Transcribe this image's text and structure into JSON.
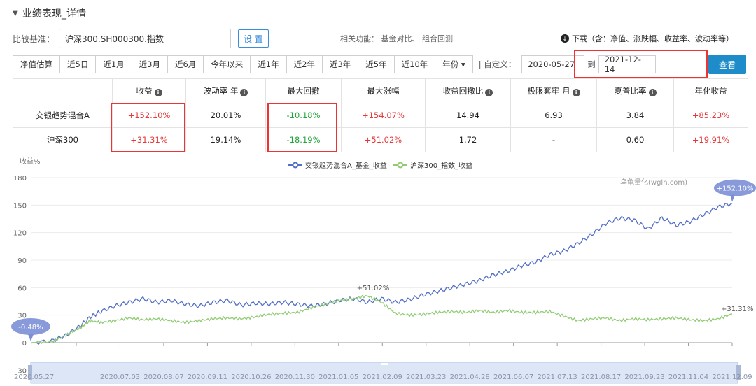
{
  "section": {
    "title": "业绩表现_详情"
  },
  "benchmark": {
    "label": "比较基准：",
    "value": "沪深300.SH000300.指数",
    "set_label": "设 置",
    "related": "相关功能： 基金对比、 组合回测",
    "download": "下载（含：净值、涨跌幅、收益率、波动率等）"
  },
  "periods": [
    "净值估算",
    "近5日",
    "近1月",
    "近3月",
    "近6月",
    "今年以来",
    "近1年",
    "近2年",
    "近3年",
    "近5年",
    "近10年",
    "年份 ▾"
  ],
  "custom": {
    "label": "| 自定义：",
    "start": "2020-05-27",
    "to": "到",
    "end": "2021-12-14",
    "query_label": "查看"
  },
  "table": {
    "headers": [
      "",
      "收益",
      "波动率 年",
      "最大回撤",
      "最大涨幅",
      "收益回撤比",
      "极限套牢 月",
      "夏普比率",
      "年化收益"
    ],
    "rows": [
      [
        "交银趋势混合A",
        "+152.10%",
        "20.01%",
        "-10.18%",
        "+154.07%",
        "14.94",
        "6.93",
        "3.84",
        "+85.23%"
      ],
      [
        "沪深300",
        "+31.31%",
        "19.14%",
        "-18.19%",
        "+51.02%",
        "1.72",
        "-",
        "0.60",
        "+19.91%"
      ]
    ]
  },
  "chart_data": {
    "type": "line",
    "ylabel": "收益%",
    "yticks": [
      -30,
      0,
      30,
      60,
      90,
      120,
      150,
      180
    ],
    "ylim": [
      -30,
      180
    ],
    "xticks": [
      "2020.05.27",
      "2020.07.03",
      "2020.08.07",
      "2020.09.11",
      "2020.10.26",
      "2020.11.30",
      "2021.01.05",
      "2021.02.09",
      "2021.03.23",
      "2021.04.28",
      "2021.06.07",
      "2021.07.13",
      "2021.08.17",
      "2021.09.23",
      "2021.11.04",
      "2021.12.09"
    ],
    "watermark": "乌龟量化(wglh.com)",
    "annotations": {
      "start": "-0.48%",
      "fund_end": "+152.10%",
      "index_end": "+31.31%",
      "index_peak": "+51.02%"
    },
    "series": [
      {
        "name": "交银趋势混合A_基金_收益",
        "color": "#5470c6",
        "points": [
          [
            0,
            -0.48
          ],
          [
            0.03,
            2
          ],
          [
            0.05,
            8
          ],
          [
            0.07,
            18
          ],
          [
            0.085,
            28
          ],
          [
            0.1,
            34
          ],
          [
            0.12,
            40
          ],
          [
            0.14,
            44
          ],
          [
            0.16,
            48
          ],
          [
            0.18,
            44
          ],
          [
            0.2,
            46
          ],
          [
            0.22,
            42
          ],
          [
            0.24,
            40
          ],
          [
            0.26,
            44
          ],
          [
            0.28,
            46
          ],
          [
            0.3,
            41
          ],
          [
            0.32,
            43
          ],
          [
            0.34,
            42
          ],
          [
            0.36,
            44
          ],
          [
            0.38,
            42
          ],
          [
            0.4,
            40
          ],
          [
            0.42,
            42
          ],
          [
            0.44,
            46
          ],
          [
            0.46,
            48
          ],
          [
            0.48,
            44
          ],
          [
            0.5,
            48
          ],
          [
            0.52,
            44
          ],
          [
            0.54,
            47
          ],
          [
            0.56,
            52
          ],
          [
            0.58,
            56
          ],
          [
            0.6,
            60
          ],
          [
            0.62,
            64
          ],
          [
            0.64,
            68
          ],
          [
            0.66,
            74
          ],
          [
            0.68,
            78
          ],
          [
            0.7,
            84
          ],
          [
            0.72,
            88
          ],
          [
            0.74,
            96
          ],
          [
            0.76,
            100
          ],
          [
            0.78,
            108
          ],
          [
            0.8,
            118
          ],
          [
            0.82,
            130
          ],
          [
            0.84,
            136
          ],
          [
            0.86,
            134
          ],
          [
            0.88,
            124
          ],
          [
            0.9,
            136
          ],
          [
            0.92,
            128
          ],
          [
            0.94,
            132
          ],
          [
            0.96,
            140
          ],
          [
            0.98,
            148
          ],
          [
            1.0,
            152.1
          ]
        ]
      },
      {
        "name": "沪深300_指数_收益",
        "color": "#91cc75",
        "points": [
          [
            0,
            0
          ],
          [
            0.03,
            1
          ],
          [
            0.05,
            8
          ],
          [
            0.07,
            16
          ],
          [
            0.085,
            24
          ],
          [
            0.1,
            22
          ],
          [
            0.12,
            24
          ],
          [
            0.14,
            27
          ],
          [
            0.16,
            25
          ],
          [
            0.18,
            26
          ],
          [
            0.2,
            24
          ],
          [
            0.22,
            22
          ],
          [
            0.24,
            24
          ],
          [
            0.26,
            26
          ],
          [
            0.28,
            27
          ],
          [
            0.3,
            26
          ],
          [
            0.32,
            28
          ],
          [
            0.34,
            31
          ],
          [
            0.36,
            32
          ],
          [
            0.38,
            33
          ],
          [
            0.4,
            38
          ],
          [
            0.42,
            42
          ],
          [
            0.44,
            46
          ],
          [
            0.46,
            48
          ],
          [
            0.48,
            51.02
          ],
          [
            0.5,
            44
          ],
          [
            0.52,
            32
          ],
          [
            0.54,
            30
          ],
          [
            0.56,
            31
          ],
          [
            0.58,
            33
          ],
          [
            0.6,
            34
          ],
          [
            0.62,
            33
          ],
          [
            0.64,
            35
          ],
          [
            0.66,
            33
          ],
          [
            0.68,
            35
          ],
          [
            0.7,
            33
          ],
          [
            0.72,
            33
          ],
          [
            0.74,
            34
          ],
          [
            0.76,
            29
          ],
          [
            0.78,
            24
          ],
          [
            0.8,
            26
          ],
          [
            0.82,
            27
          ],
          [
            0.84,
            24
          ],
          [
            0.86,
            26
          ],
          [
            0.88,
            25
          ],
          [
            0.9,
            26
          ],
          [
            0.92,
            27
          ],
          [
            0.94,
            25
          ],
          [
            0.96,
            24
          ],
          [
            0.98,
            26
          ],
          [
            1.0,
            31.31
          ]
        ]
      }
    ]
  },
  "colors": {
    "accent": "#1e8cc8",
    "positive": "#e5383b",
    "negative": "#22a33a",
    "highlight": "#e33333"
  }
}
